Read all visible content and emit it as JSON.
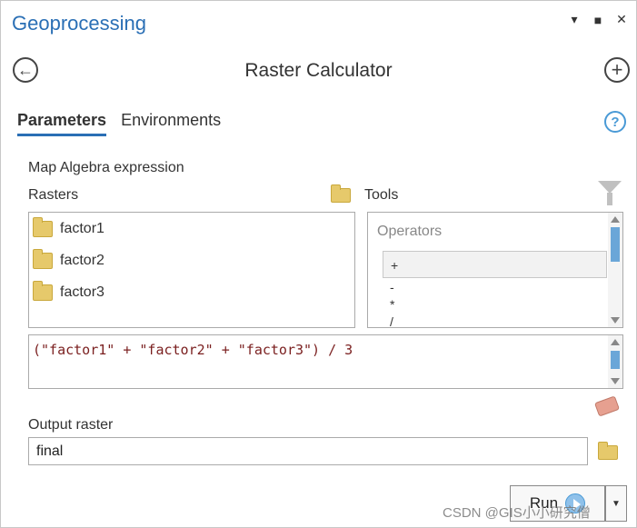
{
  "window": {
    "title": "Geoprocessing",
    "controls": {
      "menu": "▾",
      "maximize": "■",
      "close": "✕"
    }
  },
  "header": {
    "tool_title": "Raster Calculator",
    "back_icon": "←",
    "add_icon": "+"
  },
  "tabs": [
    {
      "label": "Parameters",
      "active": true
    },
    {
      "label": "Environments",
      "active": false
    }
  ],
  "help_icon": "?",
  "map_algebra": {
    "label": "Map Algebra expression",
    "rasters_label": "Rasters",
    "tools_label": "Tools",
    "rasters": [
      "factor1",
      "factor2",
      "factor3"
    ],
    "operators_title": "Operators",
    "operators": [
      "+",
      "-",
      "*",
      "/"
    ],
    "expression": "(\"factor1\" + \"factor2\" + \"factor3\") / 3"
  },
  "output": {
    "label": "Output raster",
    "value": "final"
  },
  "run": {
    "label": "Run",
    "dropdown": "▼"
  },
  "watermark": "CSDN @GIS小小研究僧",
  "colors": {
    "accent": "#2a6fb5",
    "folder": "#e6c96b",
    "scroll_thumb": "#6aa6d8",
    "expression_text": "#7a1f1f"
  }
}
